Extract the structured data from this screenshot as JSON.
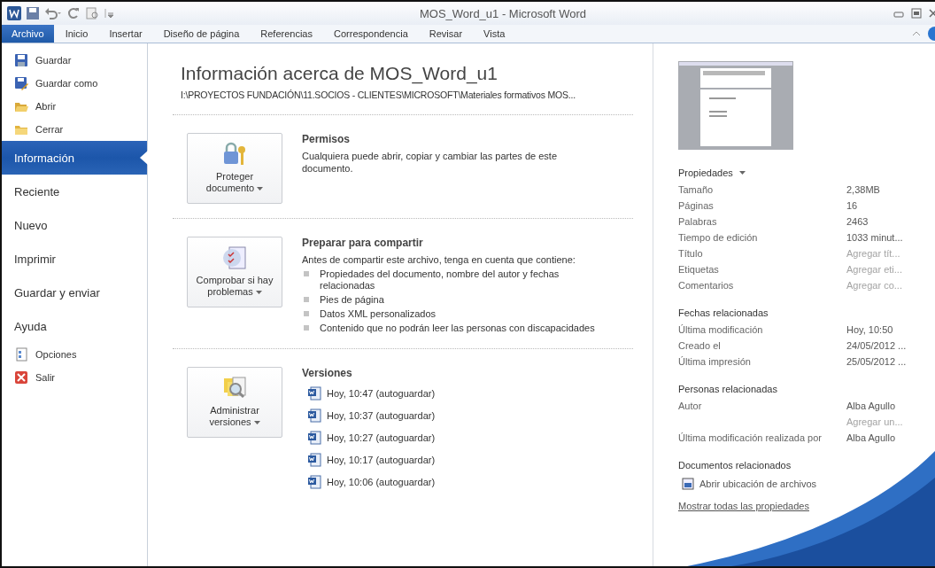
{
  "window": {
    "title": "MOS_Word_u1  -  Microsoft Word"
  },
  "ribbon_tabs": [
    {
      "label": "Archivo",
      "selected": true
    },
    {
      "label": "Inicio",
      "selected": false
    },
    {
      "label": "Insertar",
      "selected": false
    },
    {
      "label": "Diseño de página",
      "selected": false
    },
    {
      "label": "Referencias",
      "selected": false
    },
    {
      "label": "Correspondencia",
      "selected": false
    },
    {
      "label": "Revisar",
      "selected": false
    },
    {
      "label": "Vista",
      "selected": false
    }
  ],
  "nav": [
    {
      "kind": "command",
      "label": "Guardar",
      "selected": false
    },
    {
      "kind": "command",
      "label": "Guardar como",
      "selected": false
    },
    {
      "kind": "command",
      "label": "Abrir",
      "selected": false
    },
    {
      "kind": "command",
      "label": "Cerrar",
      "selected": false
    },
    {
      "kind": "page",
      "label": "Información",
      "selected": true
    },
    {
      "kind": "page",
      "label": "Reciente",
      "selected": false
    },
    {
      "kind": "page",
      "label": "Nuevo",
      "selected": false
    },
    {
      "kind": "page",
      "label": "Imprimir",
      "selected": false
    },
    {
      "kind": "page",
      "label": "Guardar y enviar",
      "selected": false
    },
    {
      "kind": "page",
      "label": "Ayuda",
      "selected": false
    },
    {
      "kind": "command",
      "label": "Opciones",
      "selected": false
    },
    {
      "kind": "command",
      "label": "Salir",
      "selected": false
    }
  ],
  "info": {
    "title": "Información acerca de MOS_Word_u1",
    "path": "I:\\PROYECTOS FUNDACIÓN\\11.SOCIOS - CLIENTES\\MICROSOFT\\Materiales formativos MOS..."
  },
  "sections": [
    {
      "kind": "text",
      "button": "Proteger documento",
      "heading": "Permisos",
      "body": "Cualquiera puede abrir, copiar y cambiar las partes de este documento."
    },
    {
      "kind": "checklist",
      "button": "Comprobar si hay problemas",
      "heading": "Preparar para compartir",
      "body": "Antes de compartir este archivo, tenga en cuenta que contiene:",
      "items": [
        "Propiedades del documento, nombre del autor y fechas relacionadas",
        "Pies de página",
        "Datos XML personalizados",
        "Contenido que no podrán leer las personas con discapacidades"
      ]
    },
    {
      "kind": "versions",
      "button": "Administrar versiones",
      "heading": "Versiones",
      "items": [
        "Hoy, 10:47 (autoguardar)",
        "Hoy, 10:37 (autoguardar)",
        "Hoy, 10:27 (autoguardar)",
        "Hoy, 10:17 (autoguardar)",
        "Hoy, 10:06 (autoguardar)"
      ]
    }
  ],
  "properties": [
    {
      "heading": "Propiedades",
      "dropdown": true,
      "rows": [
        {
          "label": "Tamaño",
          "values": [
            {
              "text": "2,38MB",
              "hint": false
            }
          ]
        },
        {
          "label": "Páginas",
          "values": [
            {
              "text": "16",
              "hint": false
            }
          ]
        },
        {
          "label": "Palabras",
          "values": [
            {
              "text": "2463",
              "hint": false
            }
          ]
        },
        {
          "label": "Tiempo de edición",
          "values": [
            {
              "text": "1033 minut...",
              "hint": false
            }
          ]
        },
        {
          "label": "Título",
          "values": [
            {
              "text": "Agregar tít...",
              "hint": true
            }
          ]
        },
        {
          "label": "Etiquetas",
          "values": [
            {
              "text": "Agregar eti...",
              "hint": true
            }
          ]
        },
        {
          "label": "Comentarios",
          "values": [
            {
              "text": "Agregar co...",
              "hint": true
            }
          ]
        }
      ]
    },
    {
      "heading": "Fechas relacionadas",
      "dropdown": false,
      "rows": [
        {
          "label": "Última modificación",
          "values": [
            {
              "text": "Hoy, 10:50",
              "hint": false
            }
          ]
        },
        {
          "label": "Creado el",
          "values": [
            {
              "text": "24/05/2012 ...",
              "hint": false
            }
          ]
        },
        {
          "label": "Última impresión",
          "values": [
            {
              "text": "25/05/2012 ...",
              "hint": false
            }
          ]
        }
      ]
    },
    {
      "heading": "Personas relacionadas",
      "dropdown": false,
      "rows": [
        {
          "label": "Autor",
          "values": [
            {
              "text": "Alba Agullo",
              "hint": false
            },
            {
              "text": "Agregar un...",
              "hint": true
            }
          ]
        },
        {
          "label": "Última modificación realizada por",
          "values": [
            {
              "text": "Alba Agullo",
              "hint": false
            }
          ]
        }
      ]
    },
    {
      "heading": "Documentos relacionados",
      "dropdown": false,
      "links": [
        "Abrir ubicación de archivos"
      ]
    }
  ],
  "show_all": "Mostrar todas las propiedades"
}
